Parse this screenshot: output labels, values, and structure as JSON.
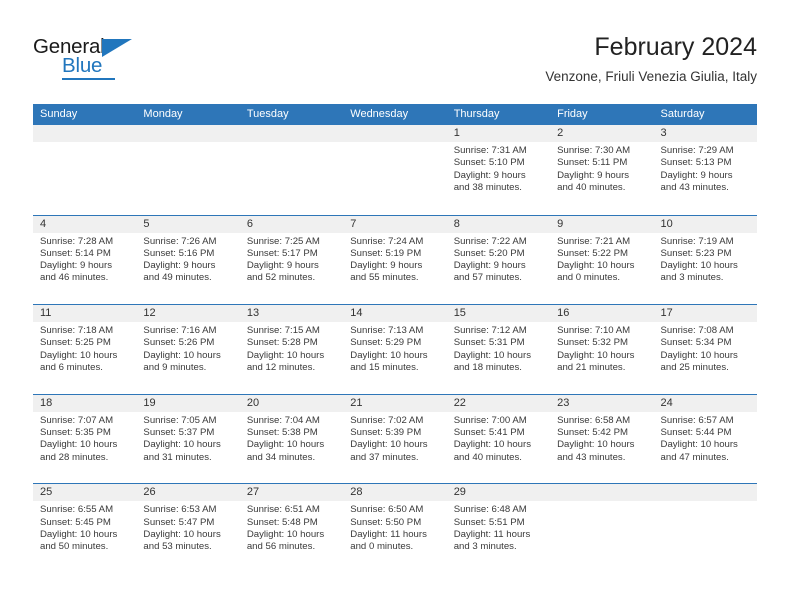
{
  "brand": {
    "name_part1": "General",
    "name_part2": "Blue",
    "logo_icon": "triangle-icon",
    "accent_color": "#2176bd"
  },
  "title": {
    "month_year": "February 2024",
    "location": "Venzone, Friuli Venezia Giulia, Italy"
  },
  "theme": {
    "header_blue": "#2e76b8",
    "date_band": "#f0f0f0",
    "text": "#3a3a3a"
  },
  "weekday_headers": [
    "Sunday",
    "Monday",
    "Tuesday",
    "Wednesday",
    "Thursday",
    "Friday",
    "Saturday"
  ],
  "weeks": [
    [
      {
        "day": "",
        "l1": "",
        "l2": "",
        "l3": "",
        "l4": ""
      },
      {
        "day": "",
        "l1": "",
        "l2": "",
        "l3": "",
        "l4": ""
      },
      {
        "day": "",
        "l1": "",
        "l2": "",
        "l3": "",
        "l4": ""
      },
      {
        "day": "",
        "l1": "",
        "l2": "",
        "l3": "",
        "l4": ""
      },
      {
        "day": "1",
        "l1": "Sunrise: 7:31 AM",
        "l2": "Sunset: 5:10 PM",
        "l3": "Daylight: 9 hours",
        "l4": "and 38 minutes."
      },
      {
        "day": "2",
        "l1": "Sunrise: 7:30 AM",
        "l2": "Sunset: 5:11 PM",
        "l3": "Daylight: 9 hours",
        "l4": "and 40 minutes."
      },
      {
        "day": "3",
        "l1": "Sunrise: 7:29 AM",
        "l2": "Sunset: 5:13 PM",
        "l3": "Daylight: 9 hours",
        "l4": "and 43 minutes."
      }
    ],
    [
      {
        "day": "4",
        "l1": "Sunrise: 7:28 AM",
        "l2": "Sunset: 5:14 PM",
        "l3": "Daylight: 9 hours",
        "l4": "and 46 minutes."
      },
      {
        "day": "5",
        "l1": "Sunrise: 7:26 AM",
        "l2": "Sunset: 5:16 PM",
        "l3": "Daylight: 9 hours",
        "l4": "and 49 minutes."
      },
      {
        "day": "6",
        "l1": "Sunrise: 7:25 AM",
        "l2": "Sunset: 5:17 PM",
        "l3": "Daylight: 9 hours",
        "l4": "and 52 minutes."
      },
      {
        "day": "7",
        "l1": "Sunrise: 7:24 AM",
        "l2": "Sunset: 5:19 PM",
        "l3": "Daylight: 9 hours",
        "l4": "and 55 minutes."
      },
      {
        "day": "8",
        "l1": "Sunrise: 7:22 AM",
        "l2": "Sunset: 5:20 PM",
        "l3": "Daylight: 9 hours",
        "l4": "and 57 minutes."
      },
      {
        "day": "9",
        "l1": "Sunrise: 7:21 AM",
        "l2": "Sunset: 5:22 PM",
        "l3": "Daylight: 10 hours",
        "l4": "and 0 minutes."
      },
      {
        "day": "10",
        "l1": "Sunrise: 7:19 AM",
        "l2": "Sunset: 5:23 PM",
        "l3": "Daylight: 10 hours",
        "l4": "and 3 minutes."
      }
    ],
    [
      {
        "day": "11",
        "l1": "Sunrise: 7:18 AM",
        "l2": "Sunset: 5:25 PM",
        "l3": "Daylight: 10 hours",
        "l4": "and 6 minutes."
      },
      {
        "day": "12",
        "l1": "Sunrise: 7:16 AM",
        "l2": "Sunset: 5:26 PM",
        "l3": "Daylight: 10 hours",
        "l4": "and 9 minutes."
      },
      {
        "day": "13",
        "l1": "Sunrise: 7:15 AM",
        "l2": "Sunset: 5:28 PM",
        "l3": "Daylight: 10 hours",
        "l4": "and 12 minutes."
      },
      {
        "day": "14",
        "l1": "Sunrise: 7:13 AM",
        "l2": "Sunset: 5:29 PM",
        "l3": "Daylight: 10 hours",
        "l4": "and 15 minutes."
      },
      {
        "day": "15",
        "l1": "Sunrise: 7:12 AM",
        "l2": "Sunset: 5:31 PM",
        "l3": "Daylight: 10 hours",
        "l4": "and 18 minutes."
      },
      {
        "day": "16",
        "l1": "Sunrise: 7:10 AM",
        "l2": "Sunset: 5:32 PM",
        "l3": "Daylight: 10 hours",
        "l4": "and 21 minutes."
      },
      {
        "day": "17",
        "l1": "Sunrise: 7:08 AM",
        "l2": "Sunset: 5:34 PM",
        "l3": "Daylight: 10 hours",
        "l4": "and 25 minutes."
      }
    ],
    [
      {
        "day": "18",
        "l1": "Sunrise: 7:07 AM",
        "l2": "Sunset: 5:35 PM",
        "l3": "Daylight: 10 hours",
        "l4": "and 28 minutes."
      },
      {
        "day": "19",
        "l1": "Sunrise: 7:05 AM",
        "l2": "Sunset: 5:37 PM",
        "l3": "Daylight: 10 hours",
        "l4": "and 31 minutes."
      },
      {
        "day": "20",
        "l1": "Sunrise: 7:04 AM",
        "l2": "Sunset: 5:38 PM",
        "l3": "Daylight: 10 hours",
        "l4": "and 34 minutes."
      },
      {
        "day": "21",
        "l1": "Sunrise: 7:02 AM",
        "l2": "Sunset: 5:39 PM",
        "l3": "Daylight: 10 hours",
        "l4": "and 37 minutes."
      },
      {
        "day": "22",
        "l1": "Sunrise: 7:00 AM",
        "l2": "Sunset: 5:41 PM",
        "l3": "Daylight: 10 hours",
        "l4": "and 40 minutes."
      },
      {
        "day": "23",
        "l1": "Sunrise: 6:58 AM",
        "l2": "Sunset: 5:42 PM",
        "l3": "Daylight: 10 hours",
        "l4": "and 43 minutes."
      },
      {
        "day": "24",
        "l1": "Sunrise: 6:57 AM",
        "l2": "Sunset: 5:44 PM",
        "l3": "Daylight: 10 hours",
        "l4": "and 47 minutes."
      }
    ],
    [
      {
        "day": "25",
        "l1": "Sunrise: 6:55 AM",
        "l2": "Sunset: 5:45 PM",
        "l3": "Daylight: 10 hours",
        "l4": "and 50 minutes."
      },
      {
        "day": "26",
        "l1": "Sunrise: 6:53 AM",
        "l2": "Sunset: 5:47 PM",
        "l3": "Daylight: 10 hours",
        "l4": "and 53 minutes."
      },
      {
        "day": "27",
        "l1": "Sunrise: 6:51 AM",
        "l2": "Sunset: 5:48 PM",
        "l3": "Daylight: 10 hours",
        "l4": "and 56 minutes."
      },
      {
        "day": "28",
        "l1": "Sunrise: 6:50 AM",
        "l2": "Sunset: 5:50 PM",
        "l3": "Daylight: 11 hours",
        "l4": "and 0 minutes."
      },
      {
        "day": "29",
        "l1": "Sunrise: 6:48 AM",
        "l2": "Sunset: 5:51 PM",
        "l3": "Daylight: 11 hours",
        "l4": "and 3 minutes."
      },
      {
        "day": "",
        "l1": "",
        "l2": "",
        "l3": "",
        "l4": ""
      },
      {
        "day": "",
        "l1": "",
        "l2": "",
        "l3": "",
        "l4": ""
      }
    ]
  ]
}
